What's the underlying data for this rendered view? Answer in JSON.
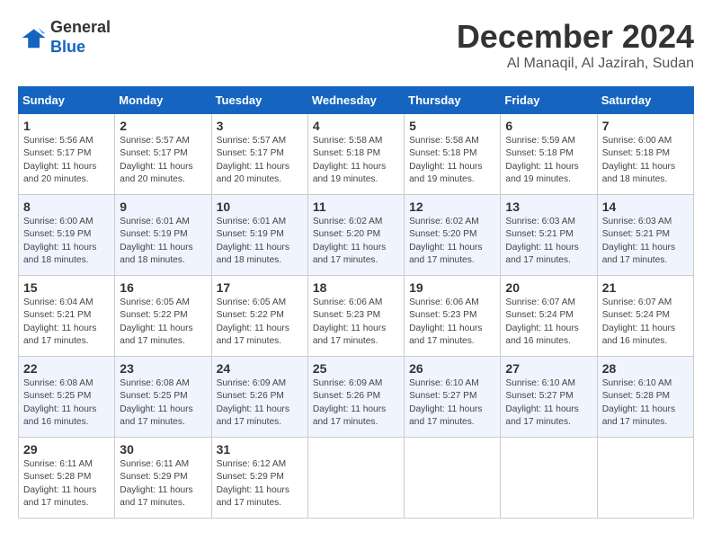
{
  "header": {
    "logo_general": "General",
    "logo_blue": "Blue",
    "month": "December 2024",
    "location": "Al Manaqil, Al Jazirah, Sudan"
  },
  "days_of_week": [
    "Sunday",
    "Monday",
    "Tuesday",
    "Wednesday",
    "Thursday",
    "Friday",
    "Saturday"
  ],
  "weeks": [
    [
      {
        "day": "1",
        "text": "Sunrise: 5:56 AM\nSunset: 5:17 PM\nDaylight: 11 hours and 20 minutes."
      },
      {
        "day": "2",
        "text": "Sunrise: 5:57 AM\nSunset: 5:17 PM\nDaylight: 11 hours and 20 minutes."
      },
      {
        "day": "3",
        "text": "Sunrise: 5:57 AM\nSunset: 5:17 PM\nDaylight: 11 hours and 20 minutes."
      },
      {
        "day": "4",
        "text": "Sunrise: 5:58 AM\nSunset: 5:18 PM\nDaylight: 11 hours and 19 minutes."
      },
      {
        "day": "5",
        "text": "Sunrise: 5:58 AM\nSunset: 5:18 PM\nDaylight: 11 hours and 19 minutes."
      },
      {
        "day": "6",
        "text": "Sunrise: 5:59 AM\nSunset: 5:18 PM\nDaylight: 11 hours and 19 minutes."
      },
      {
        "day": "7",
        "text": "Sunrise: 6:00 AM\nSunset: 5:18 PM\nDaylight: 11 hours and 18 minutes."
      }
    ],
    [
      {
        "day": "8",
        "text": "Sunrise: 6:00 AM\nSunset: 5:19 PM\nDaylight: 11 hours and 18 minutes."
      },
      {
        "day": "9",
        "text": "Sunrise: 6:01 AM\nSunset: 5:19 PM\nDaylight: 11 hours and 18 minutes."
      },
      {
        "day": "10",
        "text": "Sunrise: 6:01 AM\nSunset: 5:19 PM\nDaylight: 11 hours and 18 minutes."
      },
      {
        "day": "11",
        "text": "Sunrise: 6:02 AM\nSunset: 5:20 PM\nDaylight: 11 hours and 17 minutes."
      },
      {
        "day": "12",
        "text": "Sunrise: 6:02 AM\nSunset: 5:20 PM\nDaylight: 11 hours and 17 minutes."
      },
      {
        "day": "13",
        "text": "Sunrise: 6:03 AM\nSunset: 5:21 PM\nDaylight: 11 hours and 17 minutes."
      },
      {
        "day": "14",
        "text": "Sunrise: 6:03 AM\nSunset: 5:21 PM\nDaylight: 11 hours and 17 minutes."
      }
    ],
    [
      {
        "day": "15",
        "text": "Sunrise: 6:04 AM\nSunset: 5:21 PM\nDaylight: 11 hours and 17 minutes."
      },
      {
        "day": "16",
        "text": "Sunrise: 6:05 AM\nSunset: 5:22 PM\nDaylight: 11 hours and 17 minutes."
      },
      {
        "day": "17",
        "text": "Sunrise: 6:05 AM\nSunset: 5:22 PM\nDaylight: 11 hours and 17 minutes."
      },
      {
        "day": "18",
        "text": "Sunrise: 6:06 AM\nSunset: 5:23 PM\nDaylight: 11 hours and 17 minutes."
      },
      {
        "day": "19",
        "text": "Sunrise: 6:06 AM\nSunset: 5:23 PM\nDaylight: 11 hours and 17 minutes."
      },
      {
        "day": "20",
        "text": "Sunrise: 6:07 AM\nSunset: 5:24 PM\nDaylight: 11 hours and 16 minutes."
      },
      {
        "day": "21",
        "text": "Sunrise: 6:07 AM\nSunset: 5:24 PM\nDaylight: 11 hours and 16 minutes."
      }
    ],
    [
      {
        "day": "22",
        "text": "Sunrise: 6:08 AM\nSunset: 5:25 PM\nDaylight: 11 hours and 16 minutes."
      },
      {
        "day": "23",
        "text": "Sunrise: 6:08 AM\nSunset: 5:25 PM\nDaylight: 11 hours and 17 minutes."
      },
      {
        "day": "24",
        "text": "Sunrise: 6:09 AM\nSunset: 5:26 PM\nDaylight: 11 hours and 17 minutes."
      },
      {
        "day": "25",
        "text": "Sunrise: 6:09 AM\nSunset: 5:26 PM\nDaylight: 11 hours and 17 minutes."
      },
      {
        "day": "26",
        "text": "Sunrise: 6:10 AM\nSunset: 5:27 PM\nDaylight: 11 hours and 17 minutes."
      },
      {
        "day": "27",
        "text": "Sunrise: 6:10 AM\nSunset: 5:27 PM\nDaylight: 11 hours and 17 minutes."
      },
      {
        "day": "28",
        "text": "Sunrise: 6:10 AM\nSunset: 5:28 PM\nDaylight: 11 hours and 17 minutes."
      }
    ],
    [
      {
        "day": "29",
        "text": "Sunrise: 6:11 AM\nSunset: 5:28 PM\nDaylight: 11 hours and 17 minutes."
      },
      {
        "day": "30",
        "text": "Sunrise: 6:11 AM\nSunset: 5:29 PM\nDaylight: 11 hours and 17 minutes."
      },
      {
        "day": "31",
        "text": "Sunrise: 6:12 AM\nSunset: 5:29 PM\nDaylight: 11 hours and 17 minutes."
      },
      {
        "day": "",
        "text": ""
      },
      {
        "day": "",
        "text": ""
      },
      {
        "day": "",
        "text": ""
      },
      {
        "day": "",
        "text": ""
      }
    ]
  ]
}
